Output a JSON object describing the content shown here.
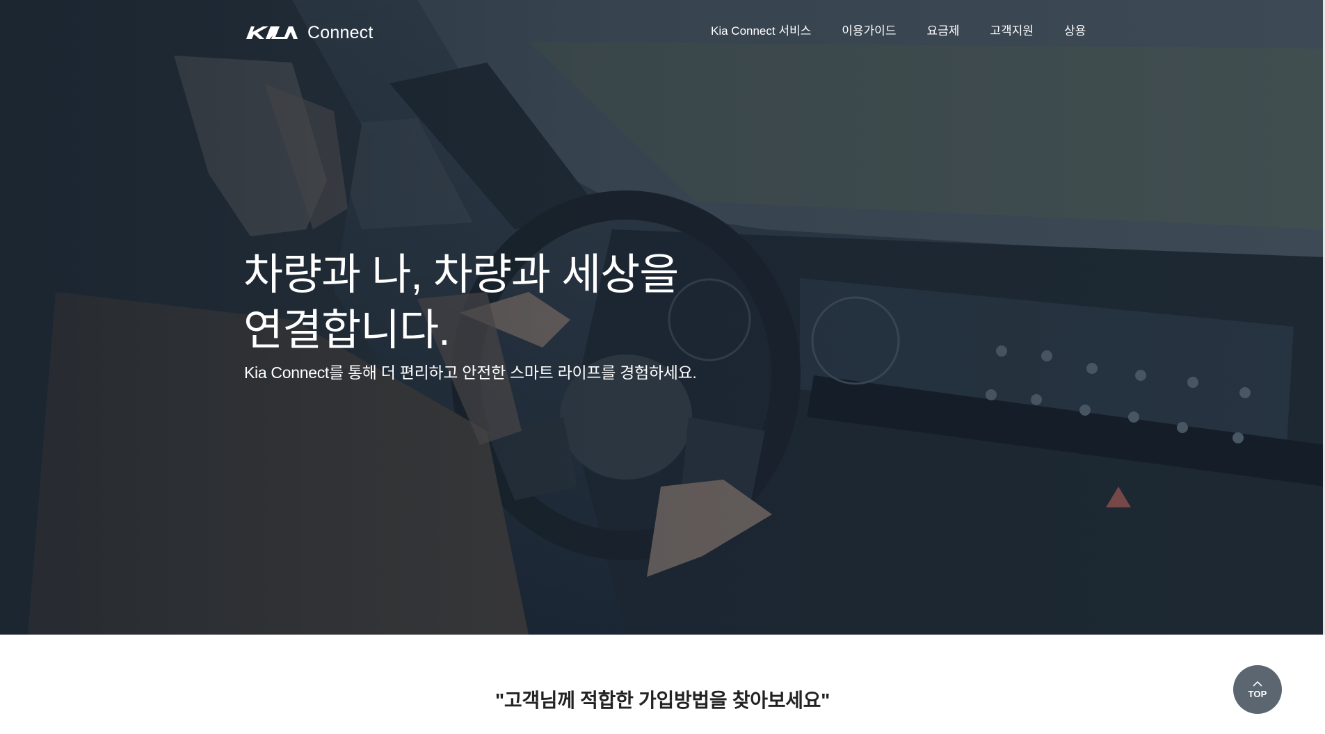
{
  "brand": {
    "logo_text": "Connect",
    "logo_mark_alt": "KIA"
  },
  "nav": {
    "items": [
      {
        "label": "Kia Connect 서비스"
      },
      {
        "label": "이용가이드"
      },
      {
        "label": "요금제"
      },
      {
        "label": "고객지원"
      },
      {
        "label": "상용"
      }
    ]
  },
  "hero": {
    "title_line1": "차량과 나, 차량과 세상을",
    "title_line2": "연결합니다.",
    "subtitle": "Kia Connect를 통해 더 편리하고 안전한 스마트 라이프를 경험하세요."
  },
  "join": {
    "heading": "\"고객님께 적합한 가입방법을 찾아보세요\""
  },
  "top_button": {
    "label": "TOP"
  },
  "colors": {
    "hero_overlay": "#2a3643",
    "top_button_bg": "#5b6670",
    "text_dark": "#222222"
  }
}
